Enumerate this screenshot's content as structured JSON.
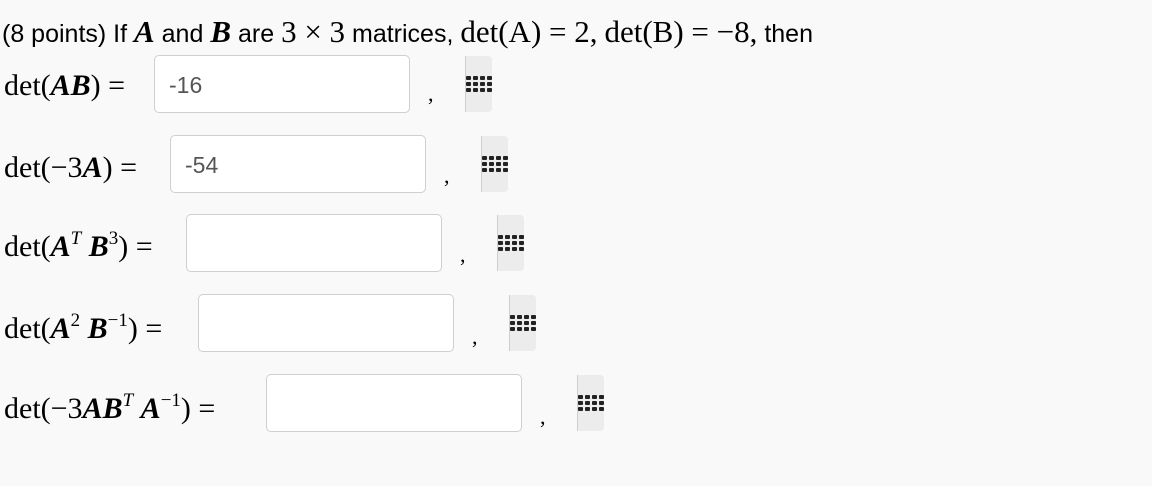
{
  "question": {
    "points": "(8 points) If",
    "a": "A",
    "and": "and",
    "b": "B",
    "are": "are",
    "dims": "3 × 3",
    "matrices": "matrices,",
    "det_a": "det(A) = 2,",
    "det_b": "det(B) = −8,",
    "then": "then"
  },
  "rows": [
    {
      "value": "-16",
      "placeholder": ""
    },
    {
      "value": "-54",
      "placeholder": ""
    },
    {
      "value": "",
      "placeholder": ""
    },
    {
      "value": "",
      "placeholder": ""
    },
    {
      "value": "",
      "placeholder": ""
    }
  ],
  "separator": ",",
  "icons": {
    "keypad": "keypad-grid-icon"
  }
}
